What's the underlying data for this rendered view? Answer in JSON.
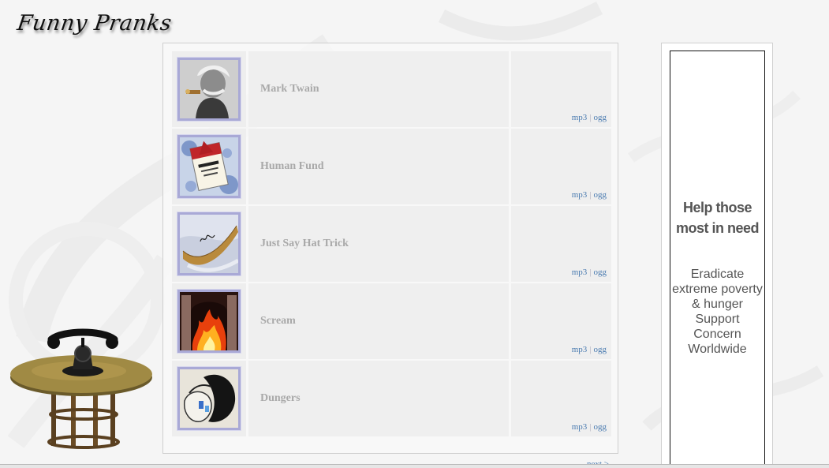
{
  "site": {
    "logo_text": "Funny Pranks"
  },
  "pranks": [
    {
      "name": "Mark Twain",
      "thumb": "mark-twain-photo",
      "mp3": "mp3",
      "ogg": "ogg"
    },
    {
      "name": "Human Fund",
      "thumb": "human-fund-card",
      "mp3": "mp3",
      "ogg": "ogg"
    },
    {
      "name": "Just Say Hat Trick",
      "thumb": "hockey-stick-signed",
      "mp3": "mp3",
      "ogg": "ogg"
    },
    {
      "name": "Scream",
      "thumb": "fireplace-fire",
      "mp3": "mp3",
      "ogg": "ogg"
    },
    {
      "name": "Dungers",
      "thumb": "dungers-bag",
      "mp3": "mp3",
      "ogg": "ogg"
    }
  ],
  "link_separator": "|",
  "pagination": {
    "next_label": "next >"
  },
  "ad": {
    "title_line1": "Help those",
    "title_line2": "most in need",
    "body_lines": [
      "Eradicate",
      "extreme poverty",
      "& hunger",
      "Support",
      "Concern",
      "Worldwide"
    ]
  },
  "colors": {
    "link": "#4a7bb0",
    "row_bg": "#efefef",
    "name_text": "#a9a9a9",
    "thumb_border": "#a9a9d6"
  }
}
